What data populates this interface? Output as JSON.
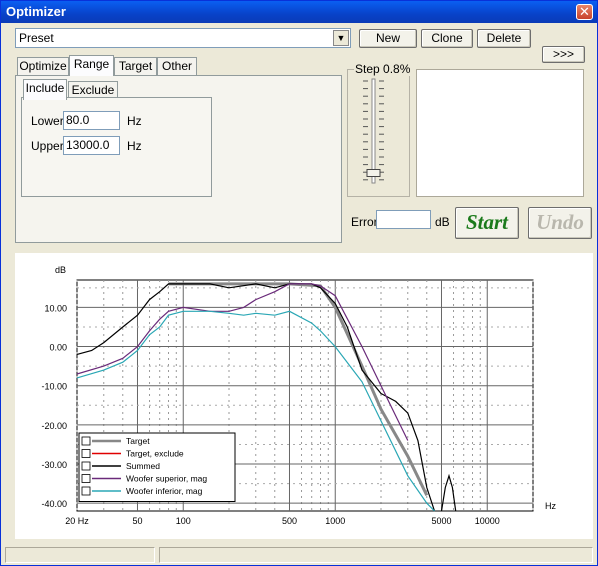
{
  "window": {
    "title": "Optimizer"
  },
  "preset": {
    "value": "Preset"
  },
  "buttons": {
    "new": "New",
    "clone": "Clone",
    "delete": "Delete",
    "expand": ">>>",
    "start": "Start",
    "undo": "Undo"
  },
  "tabs": [
    "Optimize",
    "Range",
    "Target",
    "Other"
  ],
  "subtabs": [
    "Include",
    "Exclude"
  ],
  "range": {
    "lower_label": "Lower",
    "lower_value": "80.0",
    "lower_unit": "Hz",
    "upper_label": "Upper",
    "upper_value": "13000.0",
    "upper_unit": "Hz"
  },
  "step": {
    "label": "Step 0.8%",
    "level": 0.06
  },
  "error": {
    "label": "Error",
    "value": "",
    "unit": "dB"
  },
  "colors": {
    "start": "#1b7a1b",
    "undo_disabled": "#b9b7ad",
    "summed": "#000000",
    "target": "#888888",
    "woofer_sup": "#6a2a7a",
    "woofer_inf": "#2aa7b5",
    "target_exclude": "#e00000"
  },
  "chart_data": {
    "type": "line",
    "xscale": "log",
    "xlim": [
      20,
      20000
    ],
    "ylim": [
      -42,
      17
    ],
    "xlabel": "Hz",
    "ylabel": "dB",
    "xticks": [
      20,
      50,
      100,
      500,
      1000,
      5000,
      10000
    ],
    "xtick_labels": [
      "20 Hz",
      "50",
      "100",
      "500",
      "1000",
      "5000",
      "10000"
    ],
    "yticks": [
      10,
      0,
      -10,
      -20,
      -30,
      -40
    ],
    "ytick_labels": [
      "10.00",
      "0.00",
      "-10.00",
      "-20.00",
      "-30.00",
      "-40.00"
    ],
    "legend": [
      "Target",
      "Target, exclude",
      "Summed",
      "Woofer superior, mag",
      "Woofer inferior, mag"
    ],
    "legend_colors": [
      "#888888",
      "#e00000",
      "#000000",
      "#6a2a7a",
      "#2aa7b5"
    ],
    "legend_placement": "bottom-left",
    "series": [
      {
        "name": "Target",
        "color": "#888888",
        "x": [
          80,
          200,
          500,
          800,
          1000,
          1500,
          2000,
          3000,
          4000
        ],
        "y": [
          16,
          16,
          16,
          15.5,
          10,
          -5,
          -16,
          -28,
          -38
        ]
      },
      {
        "name": "Summed",
        "color": "#000000",
        "x": [
          20,
          25,
          30,
          40,
          50,
          60,
          70,
          80,
          100,
          150,
          200,
          300,
          400,
          500,
          600,
          700,
          800,
          1000,
          1200,
          1500,
          2000,
          2500,
          3000,
          3500,
          4000,
          4500
        ],
        "y": [
          -2,
          -1,
          1,
          5,
          8,
          12,
          14,
          16,
          16,
          16,
          15,
          16,
          15,
          16,
          16,
          16,
          15,
          11,
          5,
          -6,
          -12,
          -14,
          -17,
          -24,
          -36,
          -42
        ]
      },
      {
        "name": "Woofer superior, mag",
        "color": "#6a2a7a",
        "x": [
          20,
          30,
          40,
          50,
          60,
          70,
          80,
          100,
          150,
          200,
          250,
          300,
          400,
          500,
          700,
          800,
          1000,
          1500,
          2000,
          3000
        ],
        "y": [
          -7,
          -5,
          -3,
          0,
          4,
          7,
          9,
          10,
          9,
          9,
          10,
          12,
          14,
          16,
          16,
          15.5,
          13,
          0,
          -10,
          -24
        ]
      },
      {
        "name": "Woofer inferior, mag",
        "color": "#2aa7b5",
        "x": [
          20,
          30,
          40,
          50,
          60,
          70,
          80,
          100,
          150,
          200,
          250,
          300,
          400,
          500,
          700,
          800,
          1000,
          1500,
          2000,
          3000,
          4000,
          4500
        ],
        "y": [
          -8,
          -6,
          -4,
          -1,
          3,
          5,
          8,
          9,
          9,
          8.5,
          8,
          8.5,
          8,
          9,
          6,
          4,
          0,
          -9,
          -19,
          -33,
          -40,
          -42
        ]
      },
      {
        "name": "Woofer peak",
        "color": "#000000",
        "x": [
          5000,
          5300,
          5600,
          5900,
          6200
        ],
        "y": [
          -42,
          -36,
          -33,
          -36,
          -42
        ]
      }
    ]
  }
}
